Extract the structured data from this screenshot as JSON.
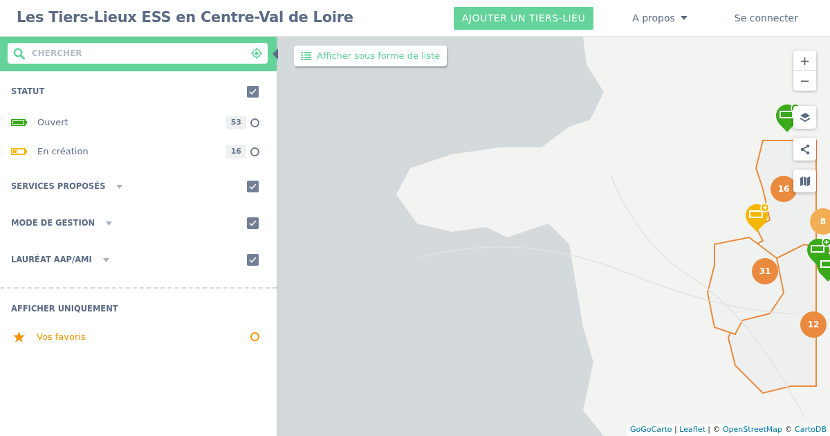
{
  "header": {
    "title": "Les Tiers-Lieux ESS en Centre-Val de Loire",
    "add_button": "AJOUTER UN TIERS-LIEU",
    "menu": "A propos",
    "login": "Se connecter"
  },
  "search": {
    "placeholder": "CHERCHER"
  },
  "filters": [
    {
      "label": "STATUT",
      "expandable": false,
      "checked": true,
      "options": [
        {
          "label": "Ouvert",
          "count": "53",
          "color": "#3aaa1c",
          "level": 1,
          "selected": false
        },
        {
          "label": "En création",
          "count": "16",
          "color": "#f5b800",
          "level": 0.3,
          "selected": false
        }
      ]
    },
    {
      "label": "SERVICES PROPOSÉS",
      "expandable": true,
      "checked": true
    },
    {
      "label": "MODE DE GESTION",
      "expandable": true,
      "checked": true
    },
    {
      "label": "LAURÉAT AAP/AMI",
      "expandable": true,
      "checked": true
    }
  ],
  "only": {
    "label": "AFFICHER UNIQUEMENT",
    "favorites": {
      "label": "Vos favoris",
      "selected": false
    }
  },
  "list_button": "Afficher sous forme de liste",
  "map": {
    "markers": [
      {
        "kind": "pin",
        "color": "#3aaa1c"
      },
      {
        "kind": "cluster",
        "count": "16",
        "color": "#ea8a3e"
      },
      {
        "kind": "pin",
        "color": "#f5b800"
      },
      {
        "kind": "cluster",
        "count": "8",
        "color": "#f2ae55"
      },
      {
        "kind": "pin",
        "color": "#3aaa1c"
      },
      {
        "kind": "pin",
        "color": "#3aaa1c"
      },
      {
        "kind": "cluster",
        "count": "31",
        "color": "#ea8a3e"
      },
      {
        "kind": "cluster",
        "count": "12",
        "color": "#ea8a3e"
      }
    ],
    "zoom_in": "+",
    "zoom_out": "−",
    "attribution": [
      {
        "text": "GoGoCarto",
        "kind": "link"
      },
      {
        "text": "|",
        "kind": "sep"
      },
      {
        "text": "Leaflet",
        "kind": "link"
      },
      {
        "text": "| ©",
        "kind": "sep"
      },
      {
        "text": "OpenStreetMap",
        "kind": "link"
      },
      {
        "text": "©",
        "kind": "sep"
      },
      {
        "text": "CartoDB",
        "kind": "link"
      }
    ]
  }
}
